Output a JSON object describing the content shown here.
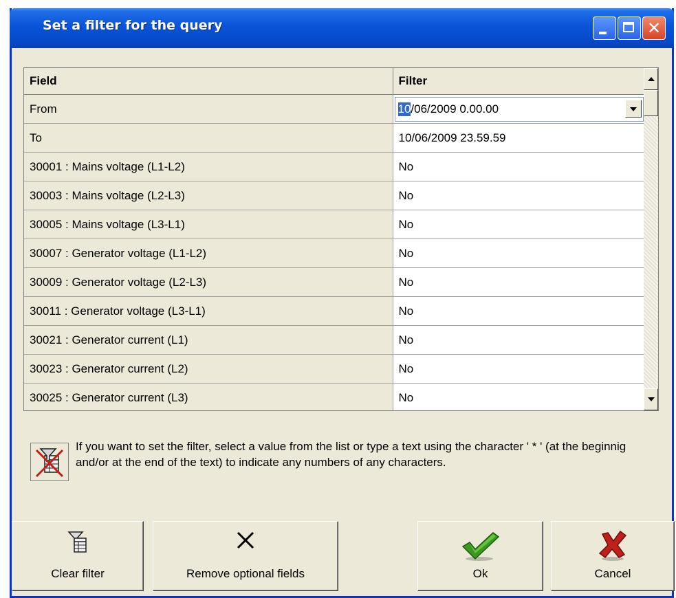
{
  "window": {
    "title": "Set a filter for the query"
  },
  "grid": {
    "columns": [
      "Field",
      "Filter"
    ],
    "rows": [
      {
        "field": "From",
        "filter": "10/06/2009  0.00.00",
        "filter_selected": "10",
        "filter_rest": "/06/2009  0.00.00"
      },
      {
        "field": "To",
        "filter": "10/06/2009 23.59.59"
      },
      {
        "field": "30001 : Mains voltage (L1-L2)",
        "filter": "No"
      },
      {
        "field": "30003 : Mains voltage (L2-L3)",
        "filter": "No"
      },
      {
        "field": "30005 : Mains voltage (L3-L1)",
        "filter": "No"
      },
      {
        "field": "30007 : Generator voltage (L1-L2)",
        "filter": "No"
      },
      {
        "field": "30009 : Generator voltage (L2-L3)",
        "filter": "No"
      },
      {
        "field": "30011 : Generator voltage (L3-L1)",
        "filter": "No"
      },
      {
        "field": "30021 : Generator current (L1)",
        "filter": "No"
      },
      {
        "field": "30023 : Generator current (L2)",
        "filter": "No"
      },
      {
        "field": "30025 : Generator current (L3)",
        "filter": "No"
      }
    ]
  },
  "info": {
    "text": "If you want to set the filter, select a value from the list or type a text using the character ' * ' (at the beginnig and/or at the end of the text) to indicate any numbers of any characters."
  },
  "buttons": {
    "clear": "Clear filter",
    "remove": "Remove optional fields",
    "ok": "Ok",
    "cancel": "Cancel"
  },
  "icons": {
    "clear": "filter-table-icon",
    "remove": "x-icon",
    "ok": "checkmark-icon",
    "cancel": "red-x-icon",
    "info": "no-filter-icon"
  },
  "colors": {
    "titlebar": "#0a54d8",
    "window_bg": "#ece9d8",
    "ok_green": "#3a9a1e",
    "cancel_red": "#c0201a",
    "selection": "#316ac5"
  }
}
